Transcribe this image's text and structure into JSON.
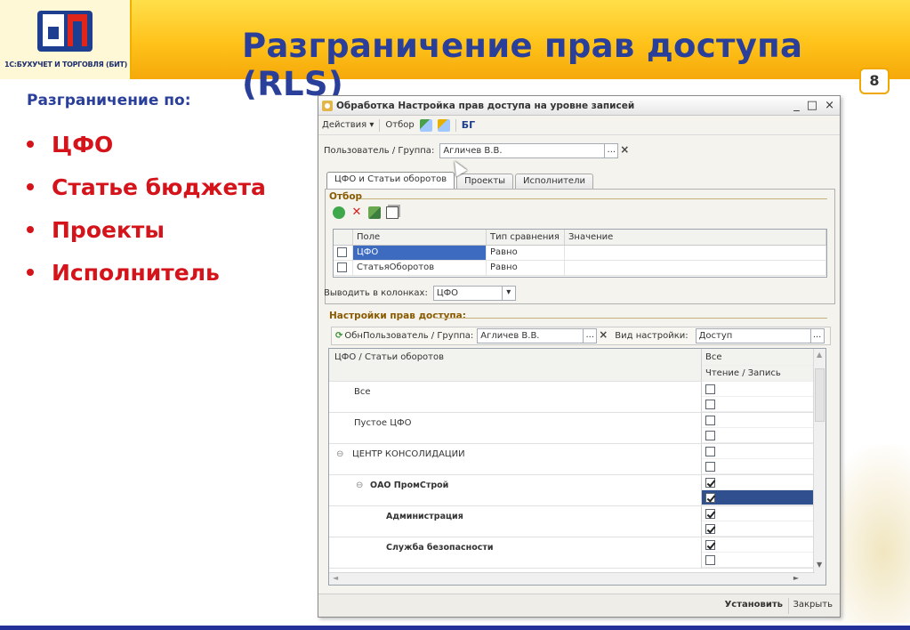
{
  "slide": {
    "logo_text": "1С:БУХУЧЕТ И ТОРГОВЛЯ (БИТ)",
    "title": "Разграничение прав доступа (RLS)",
    "page_number": "8",
    "lead": "Разграничение по:",
    "bullets": [
      "ЦФО",
      "Статье бюджета",
      "Проекты",
      "Исполнитель"
    ]
  },
  "window": {
    "title": "Обработка  Настройка прав доступа на уровне записей",
    "controls": [
      "_",
      "□",
      "×"
    ],
    "toolbar": {
      "actions": "Действия",
      "filter": "Отбор",
      "logo": "БГ"
    },
    "user_label": "Пользователь / Группа:",
    "user_value": "Агличев В.В.",
    "dots": "...",
    "clear": "×",
    "tabs": [
      "ЦФО и Статьи оборотов",
      "Проекты",
      "Исполнители"
    ],
    "filter_section": "Отбор",
    "filter_grid": {
      "headers": [
        "Поле",
        "Тип сравнения",
        "Значение"
      ],
      "rows": [
        {
          "field": "ЦФО",
          "comparison": "Равно",
          "value": ""
        },
        {
          "field": "СтатьяОборотов",
          "comparison": "Равно",
          "value": ""
        }
      ]
    },
    "columns_label": "Выводить в колонках:",
    "columns_value": "ЦФО",
    "access_section": "Настройки прав доступа:",
    "refresh_label": "Обн",
    "access_user_label": "Пользователь / Группа:",
    "access_user_value": "Агличев В.В.",
    "setting_type_label": "Вид настройки:",
    "setting_type_value": "Доступ",
    "tree": {
      "col_header": "ЦФО / Статьи оборотов",
      "right_header_1": "Все",
      "right_header_2": "Чтение / Запись",
      "rows": [
        {
          "label": "Все",
          "read": false,
          "write": false
        },
        {
          "label": "Пустое ЦФО",
          "read": false,
          "write": false
        },
        {
          "label": "ЦЕНТР КОНСОЛИДАЦИИ",
          "read": false,
          "write": false,
          "collapse": "⊖"
        },
        {
          "label": "ОАО ПромСтрой",
          "read": true,
          "write": true,
          "collapse": "⊖"
        },
        {
          "label": "Администрация",
          "read": true,
          "write": true
        },
        {
          "label": "Служба безопасности",
          "read": true,
          "write": false
        }
      ]
    },
    "footer": {
      "install": "Установить",
      "close": "Закрыть"
    }
  }
}
